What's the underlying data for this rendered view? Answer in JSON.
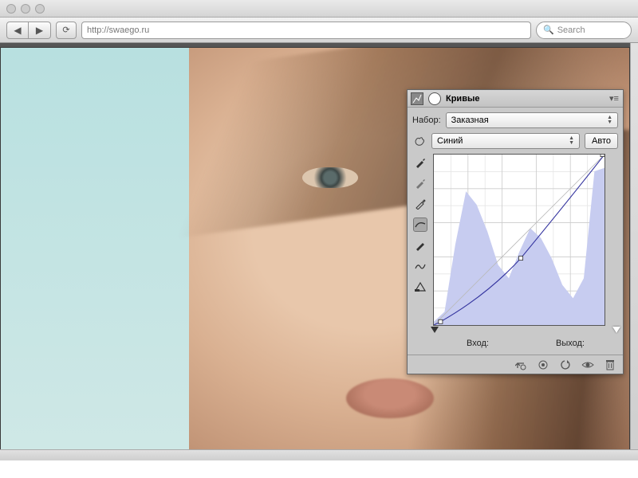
{
  "browser": {
    "url": "http://swaego.ru",
    "search_placeholder": "Search"
  },
  "panel": {
    "title": "Кривые",
    "preset_label": "Набор:",
    "preset_value": "Заказная",
    "channel_value": "Синий",
    "auto_label": "Авто",
    "input_label": "Вход:",
    "output_label": "Выход:"
  },
  "chart_data": {
    "type": "line",
    "title": "Кривые",
    "xlabel": "Вход",
    "ylabel": "Выход",
    "xlim": [
      0,
      255
    ],
    "ylim": [
      0,
      255
    ],
    "series": [
      {
        "name": "Синий",
        "points": [
          [
            0,
            0
          ],
          [
            10,
            5
          ],
          [
            130,
            100
          ],
          [
            255,
            255
          ]
        ]
      }
    ],
    "histogram": {
      "bins_x": [
        0,
        16,
        32,
        48,
        64,
        80,
        96,
        112,
        128,
        144,
        160,
        176,
        192,
        208,
        224,
        240,
        255
      ],
      "heights": [
        5,
        20,
        120,
        200,
        180,
        140,
        90,
        70,
        110,
        145,
        130,
        100,
        60,
        40,
        70,
        230
      ]
    },
    "control_points": [
      [
        10,
        5
      ],
      [
        130,
        100
      ],
      [
        255,
        255
      ]
    ],
    "black_slider": 0,
    "white_slider": 255
  }
}
